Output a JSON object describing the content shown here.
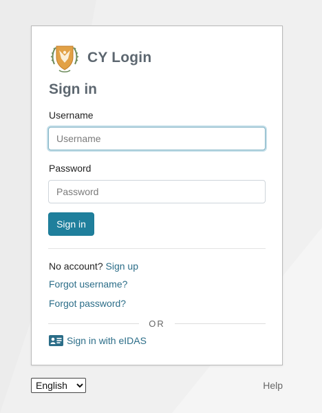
{
  "brand": {
    "name": "CY Login",
    "logo_icon": "cyprus-coat-of-arms-icon"
  },
  "form": {
    "heading": "Sign in",
    "username_label": "Username",
    "username_placeholder": "Username",
    "username_value": "",
    "password_label": "Password",
    "password_placeholder": "Password",
    "password_value": "",
    "submit_label": "Sign in"
  },
  "links": {
    "no_account_text": "No account?",
    "sign_up": "Sign up",
    "forgot_username": "Forgot username?",
    "forgot_password": "Forgot password?"
  },
  "separator": {
    "or_text": "OR"
  },
  "eidas": {
    "label": "Sign in with eIDAS",
    "icon": "id-card-icon"
  },
  "footer": {
    "language_selected": "English",
    "help": "Help"
  },
  "colors": {
    "accent": "#1f7f9c",
    "link": "#2b6d88",
    "heading": "#5d6770",
    "background": "#f0f0f0"
  }
}
